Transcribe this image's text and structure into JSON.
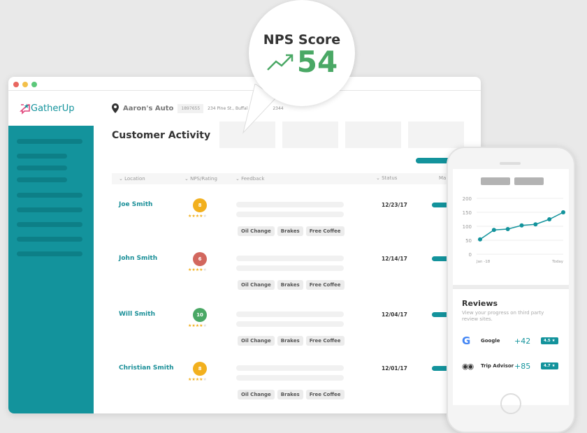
{
  "window": {
    "controls": [
      "#e8665f",
      "#f3c04a",
      "#5cc87a"
    ]
  },
  "brand": {
    "logo_text": "GatherUp",
    "accent": "#13939c",
    "logo_icon": "chat-star-icon"
  },
  "header": {
    "business": "Aaron's Auto",
    "id": "1897655",
    "address_part1": "234 Pine St., Buffal",
    "address_part2": "2344",
    "pin_icon": "map-pin-icon"
  },
  "page_title": "Customer Activity",
  "table": {
    "columns": [
      "Location",
      "NPS/Rating",
      "Feedback",
      "Status",
      "Ma"
    ],
    "rows": [
      {
        "name": "Joe Smith",
        "score": "8",
        "score_color": "#f2b01e",
        "stars": 4,
        "tags": [
          "Oil Change",
          "Brakes",
          "Free Coffee"
        ],
        "date": "12/23/17"
      },
      {
        "name": "John Smith",
        "score": "6",
        "score_color": "#d2675e",
        "stars": 4,
        "tags": [
          "Oil Change",
          "Brakes",
          "Free Coffee"
        ],
        "date": "12/14/17"
      },
      {
        "name": "Will Smith",
        "score": "10",
        "score_color": "#4aa865",
        "stars": 4,
        "tags": [
          "Oil Change",
          "Brakes",
          "Free Coffee"
        ],
        "date": "12/04/17"
      },
      {
        "name": "Christian Smith",
        "score": "8",
        "score_color": "#f2b01e",
        "stars": 4,
        "tags": [
          "Oil Change",
          "Brakes",
          "Free Coffee"
        ],
        "date": "12/01/17"
      }
    ]
  },
  "nps": {
    "label": "NPS Score",
    "value": "54",
    "color": "#4aa865",
    "icon": "trending-up-icon"
  },
  "phone": {
    "chart_data": {
      "type": "line",
      "y_ticks": [
        0,
        50,
        100,
        150,
        200
      ],
      "ylim": [
        0,
        200
      ],
      "x_labels": [
        "Jan -18",
        "Today"
      ],
      "values": [
        53,
        87,
        90,
        103,
        107,
        125,
        150
      ],
      "grid": true,
      "color": "#13939c"
    },
    "reviews": {
      "title": "Reviews",
      "subtitle": "View your progress on third party review sites.",
      "sites": [
        {
          "name": "Google",
          "icon": "google-icon",
          "delta": "+42",
          "rating": "4.5 ★"
        },
        {
          "name": "Trip Advisor",
          "icon": "tripadvisor-icon",
          "delta": "+85",
          "rating": "4.7 ★"
        }
      ]
    }
  }
}
